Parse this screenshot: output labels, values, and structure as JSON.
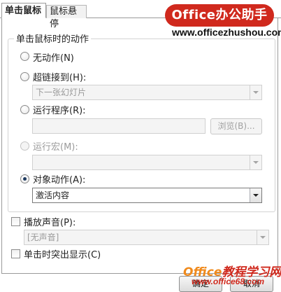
{
  "tabs": [
    {
      "label": "单击鼠标",
      "selected": true
    },
    {
      "label": "鼠标悬停",
      "selected": false
    }
  ],
  "watermark": {
    "brand": "Office办公助手",
    "url": "www.officezhushou.com",
    "bottom_brand_a": "Office",
    "bottom_brand_b": "教程学习网",
    "bottom_url": "www.office68.com"
  },
  "group": {
    "title": "单击鼠标时的动作"
  },
  "options": {
    "none": {
      "label": "无动作(N)",
      "selected": false
    },
    "hyperlink": {
      "label": "超链接到(H):",
      "selected": false,
      "value": "下一张幻灯片"
    },
    "run_program": {
      "label": "运行程序(R):",
      "selected": false,
      "value": "",
      "browse_label": "浏览(B)..."
    },
    "run_macro": {
      "label": "运行宏(M):",
      "selected": false,
      "disabled": true,
      "value": ""
    },
    "object_action": {
      "label": "对象动作(A):",
      "selected": true,
      "value": "激活内容"
    }
  },
  "sound": {
    "label": "播放声音(P):",
    "checked": false,
    "value": "[无声音]"
  },
  "highlight": {
    "label": "单击时突出显示(C)",
    "checked": false
  },
  "buttons": {
    "ok": "确定",
    "cancel": "取消"
  }
}
